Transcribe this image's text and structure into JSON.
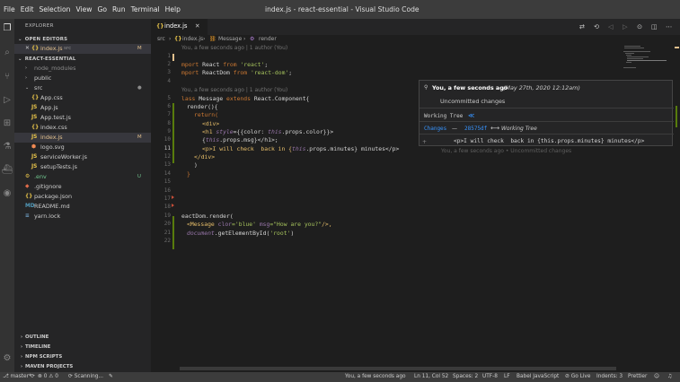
{
  "window": {
    "title": "index.js - react-essential - Visual Studio Code"
  },
  "menu": [
    "File",
    "Edit",
    "Selection",
    "View",
    "Go",
    "Run",
    "Terminal",
    "Help"
  ],
  "sidebar": {
    "title": "EXPLORER",
    "open_editors_header": "OPEN EDITORS",
    "open_editor": {
      "close": "✕",
      "icon": "{}",
      "name": "index.js",
      "path": "src",
      "status": "M"
    },
    "project_header": "REACT-ESSENTIAL",
    "tree": [
      {
        "type": "folder",
        "name": "node_modules",
        "dim": true
      },
      {
        "type": "folder",
        "name": "public"
      },
      {
        "type": "folder-open",
        "name": "src",
        "dot": "●"
      },
      {
        "type": "file",
        "icon": "{}",
        "name": "App.css"
      },
      {
        "type": "file",
        "icon": "JS",
        "name": "App.js"
      },
      {
        "type": "file",
        "icon": "JS",
        "name": "App.test.js"
      },
      {
        "type": "file",
        "icon": "{}",
        "name": "index.css"
      },
      {
        "type": "file",
        "icon": "JS",
        "name": "index.js",
        "status": "M",
        "selected": true
      },
      {
        "type": "file",
        "icon": "⬢",
        "name": "logo.svg"
      },
      {
        "type": "file",
        "icon": "JS",
        "name": "serviceWorker.js"
      },
      {
        "type": "file",
        "icon": "JS",
        "name": "setupTests.js"
      },
      {
        "type": "file",
        "icon": "⚙",
        "name": ".env",
        "status": "U",
        "root": true
      },
      {
        "type": "file",
        "icon": "◆",
        "name": ".gitignore",
        "root": true
      },
      {
        "type": "file",
        "icon": "{}",
        "name": "package.json",
        "root": true
      },
      {
        "type": "file",
        "icon": "MD",
        "name": "README.md",
        "root": true
      },
      {
        "type": "file",
        "icon": "≡",
        "name": "yarn.lock",
        "root": true
      }
    ],
    "bottom_sections": [
      "OUTLINE",
      "TIMELINE",
      "NPM SCRIPTS",
      "MAVEN PROJECTS"
    ]
  },
  "tab": {
    "icon": "{}",
    "label": "index.js",
    "close": "✕"
  },
  "breadcrumb": {
    "folder": "src",
    "sep": "›",
    "file_icon": "{}",
    "file": "index.js",
    "symbol1": "Message",
    "symbol2": "render"
  },
  "editor": {
    "blame_top": "You, a few seconds ago | 1 author (You)",
    "blame_class": "You, a few seconds ago | 1 author (You)",
    "line_numbers": [
      "1",
      "2",
      "3",
      "4",
      "5",
      "6",
      "7",
      "8",
      "9",
      "10",
      "11",
      "12",
      "13",
      "14",
      "15",
      "16",
      "17",
      "18",
      "19",
      "20",
      "21",
      "22"
    ],
    "code": {
      "l2": [
        "mport ",
        "React",
        " from ",
        "'react'",
        ";"
      ],
      "l3": [
        "mport ",
        "ReactDom",
        " from ",
        "'react-dom'",
        ";"
      ],
      "l5": [
        "lass ",
        "Message",
        " extends ",
        "React.Component",
        "{"
      ],
      "l6": "render(){",
      "l7": "return(",
      "l8": "<div>",
      "l9": [
        "<h1 ",
        "style",
        "={{color: ",
        "this",
        ".props.color}}>"
      ],
      "l10": [
        "{",
        "this",
        ".props.msg}</h1>;"
      ],
      "l11a": "<p>I will check  back in {",
      "l11b": "this",
      "l11c": ".props.minutes} minutes</p>",
      "l12": "</div>",
      "l13": ")",
      "l14": "}",
      "l19": "eactDom.render(",
      "l20": [
        "<Message ",
        "clor",
        "='blue' ",
        "msg",
        "=\"How are you?\"",
        "/>,"
      ],
      "l21": [
        "document",
        ".getElementById(",
        "'root'",
        ")"
      ]
    },
    "inline_blame": "You, a few seconds ago • Uncommitted changes"
  },
  "hover": {
    "author_icon": "👤",
    "author": "You, a few seconds ago",
    "date": "(May 27th, 2020 12:12am)",
    "message": "Uncommitted changes",
    "working_tree": "Working Tree",
    "wt_icon": "≪",
    "changes": "Changes",
    "dash": "—",
    "sha": "28575df",
    "arrow": "⟷",
    "target": "Working Tree",
    "diff_plus": "+",
    "diff": "<p>I will check  back in {this.props.minutes} minutes</p>"
  },
  "toolbar_icons": [
    "compare-icon",
    "history-icon",
    "back-icon",
    "forward-icon",
    "git-icon",
    "split-icon",
    "more-icon"
  ],
  "toolbar_glyphs": [
    "⇄",
    "⟲",
    "◁",
    "▷",
    "⊙",
    "◫",
    "⋯"
  ],
  "statusbar": {
    "branch": "⎇ master*",
    "sync": "⟳",
    "problems": "⊗ 0 ⚠ 0",
    "scanning": "⟳ Scanning...",
    "blame": "You, a few seconds ago",
    "position": "Ln 11, Col 52",
    "spaces": "Spaces: 2",
    "encoding": "UTF-8",
    "eol": "LF",
    "language": "Babel JavaScript",
    "golive": "⊘ Go Live",
    "indents": "Indents: 3",
    "prettier": "Prettier",
    "bell": "🔔"
  }
}
